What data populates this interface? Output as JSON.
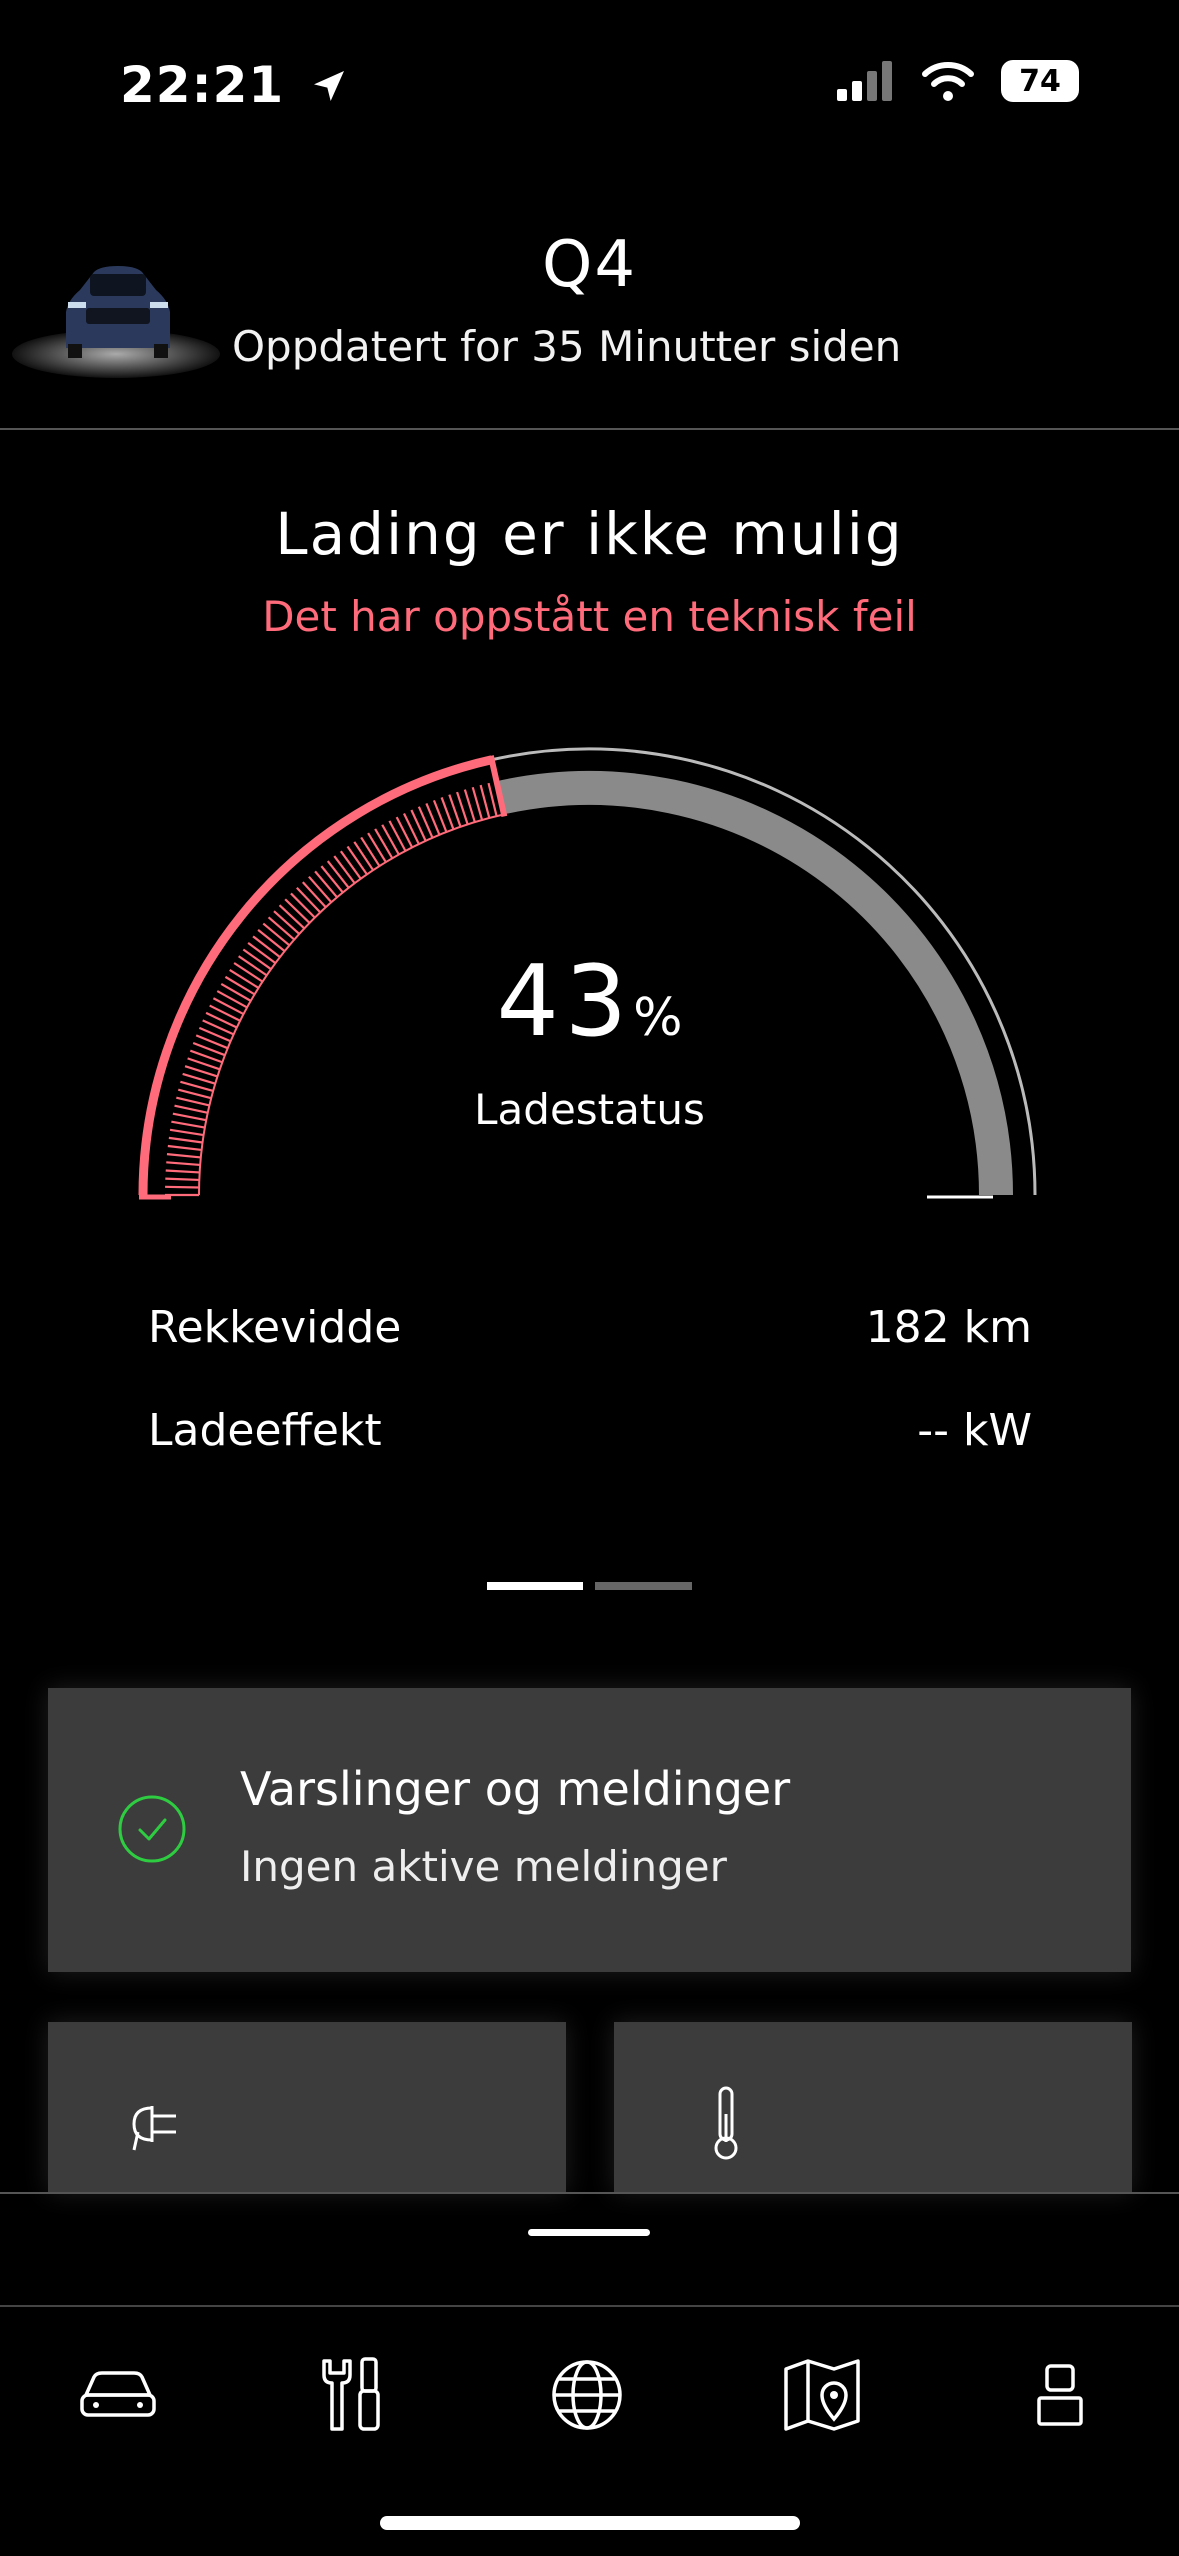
{
  "status_bar": {
    "time": "22:21",
    "battery": "74"
  },
  "header": {
    "title": "Q4",
    "subtitle": "Oppdatert for 35 Minutter siden"
  },
  "charging": {
    "title": "Lading er ikke mulig",
    "error": "Det har oppstått en teknisk feil",
    "percent": "43",
    "percent_unit": "%",
    "label": "Ladestatus",
    "level_fraction": 0.43
  },
  "stats": [
    {
      "label": "Rekkevidde",
      "value": "182 km"
    },
    {
      "label": "Ladeeffekt",
      "value": "-- kW"
    }
  ],
  "alerts": {
    "title": "Varslinger og meldinger",
    "subtitle": "Ingen aktive meldinger"
  },
  "tiles": [
    {
      "icon": "charging-plug-icon"
    },
    {
      "icon": "thermometer-icon"
    }
  ],
  "nav": [
    {
      "icon": "car-icon"
    },
    {
      "icon": "tools-icon"
    },
    {
      "icon": "globe-icon"
    },
    {
      "icon": "map-icon"
    },
    {
      "icon": "profile-icon"
    }
  ],
  "colors": {
    "accent_red": "#ff6b7a",
    "gauge_gray": "#8a8a8a",
    "success_green": "#2ecc40"
  }
}
